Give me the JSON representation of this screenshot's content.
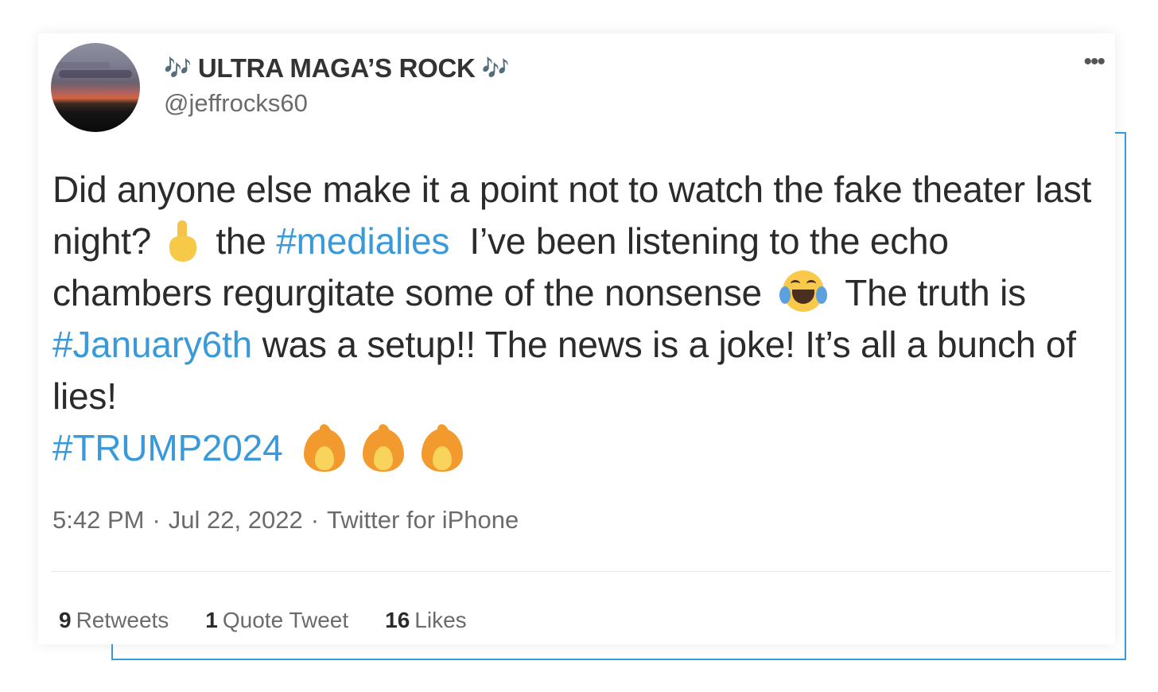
{
  "user": {
    "display_name": "ULTRA MAGA’S ROCK",
    "name_emoji": "🎶",
    "handle": "@jeffrocks60"
  },
  "more_icon": "ellipsis-icon",
  "tweet": {
    "t1": "Did anyone else make it a point not to watch the fake theater last night?",
    "t2": "the",
    "hashtag1": "#medialies",
    "t3": "I’ve been listening to the echo chambers regurgitate some of the nonsense",
    "t4": "The truth is",
    "hashtag2": "#January6th",
    "t5": "was a setup!! The news is a joke! It’s all a bunch of lies!",
    "hashtag3": "#TRUMP2024"
  },
  "meta": {
    "time": "5:42 PM",
    "sep1": "·",
    "date": "Jul 22, 2022",
    "sep2": "·",
    "source": "Twitter for iPhone"
  },
  "stats": {
    "retweets_count": "9",
    "retweets_label": "Retweets",
    "quotes_count": "1",
    "quotes_label": "Quote Tweet",
    "likes_count": "16",
    "likes_label": "Likes"
  },
  "colors": {
    "hashtag": "#3a9ad9",
    "accent_frame": "#3a9ad9",
    "text": "#2b2b2b",
    "muted": "#6b6b6b"
  }
}
